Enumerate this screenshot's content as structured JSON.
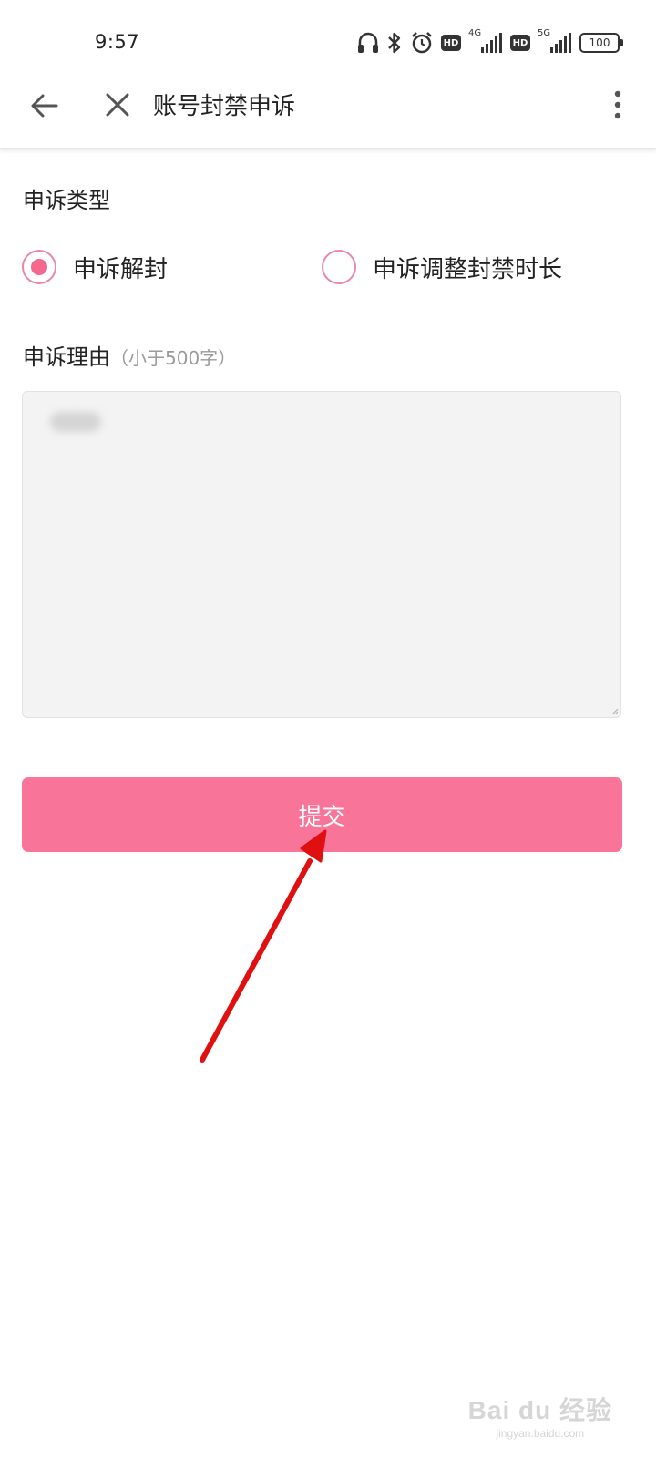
{
  "status_bar": {
    "time": "9:57",
    "icons": [
      "headphones-icon",
      "bluetooth-icon",
      "alarm-icon",
      "hd-icon",
      "signal-4g-icon",
      "hd-icon",
      "signal-5g-icon",
      "battery-icon"
    ],
    "net1": "4G",
    "net2": "5G",
    "hd": "HD",
    "battery": "100"
  },
  "app_bar": {
    "title": "账号封禁申诉"
  },
  "form": {
    "type_label": "申诉类型",
    "options": [
      {
        "label": "申诉解封",
        "selected": true
      },
      {
        "label": "申诉调整封禁时长",
        "selected": false
      }
    ],
    "reason_label": "申诉理由",
    "reason_hint": "（小于500字）",
    "submit_label": "提交"
  },
  "colors": {
    "accent": "#f87498",
    "radio_border": "#e889a3",
    "arrow": "#e01010"
  },
  "watermark": {
    "main": "Bai du 经验",
    "sub": "jingyan.baidu.com"
  }
}
